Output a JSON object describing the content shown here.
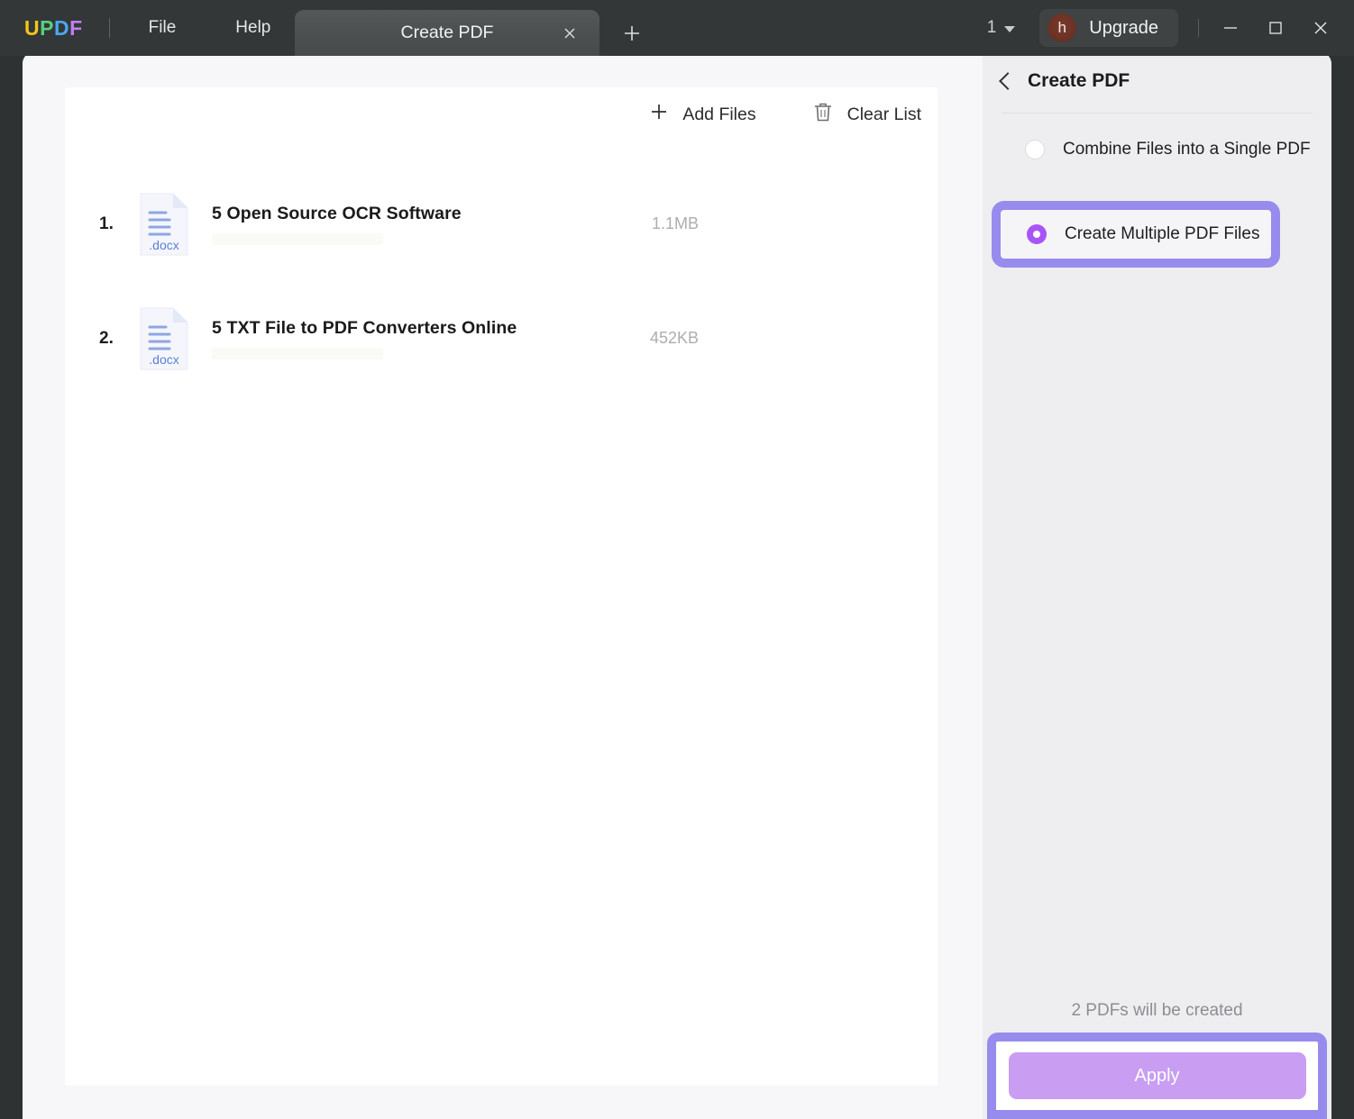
{
  "titlebar": {
    "logo": {
      "u": "U",
      "p": "P",
      "d": "D",
      "f": "F"
    },
    "menus": [
      {
        "name": "file",
        "label": "File"
      },
      {
        "name": "help",
        "label": "Help"
      }
    ],
    "tabs": [
      {
        "label": "Create PDF",
        "close_icon": "close-icon",
        "active": true
      }
    ],
    "new_tab_icon": "plus-icon",
    "page_count": "1",
    "page_count_icon": "chevron-down-icon",
    "avatar_initial": "h",
    "upgrade_label": "Upgrade",
    "window_controls": [
      {
        "name": "minimize",
        "icon": "minimize-icon"
      },
      {
        "name": "maximize",
        "icon": "maximize-icon"
      },
      {
        "name": "close",
        "icon": "close-icon"
      }
    ]
  },
  "toolbar": {
    "add_files_label": "Add Files",
    "add_files_icon": "plus-icon",
    "clear_list_label": "Clear List",
    "clear_list_icon": "trash-icon"
  },
  "files": [
    {
      "index": "1.",
      "name": "5 Open Source OCR Software",
      "size": "1.1MB",
      "type_label": ".docx",
      "icon": "docx-file-icon"
    },
    {
      "index": "2.",
      "name": "5 TXT File to PDF Converters Online",
      "size": "452KB",
      "type_label": ".docx",
      "icon": "docx-file-icon"
    }
  ],
  "panel": {
    "back_icon": "back-chevron-icon",
    "title": "Create PDF",
    "options": [
      {
        "label": "Combine Files into a Single PDF",
        "selected": false
      },
      {
        "label": "Create Multiple PDF Files",
        "selected": true
      }
    ],
    "status_text": "2 PDFs will be created",
    "apply_label": "Apply"
  },
  "colors": {
    "accent_purple": "#a855f7",
    "highlight_border": "#978ced",
    "apply_button": "#c89df2",
    "titlebar": "#333738",
    "panel_bg": "#eeedf0",
    "card_bg": "#ffffff",
    "docx_blue": "#5a7fd6"
  }
}
